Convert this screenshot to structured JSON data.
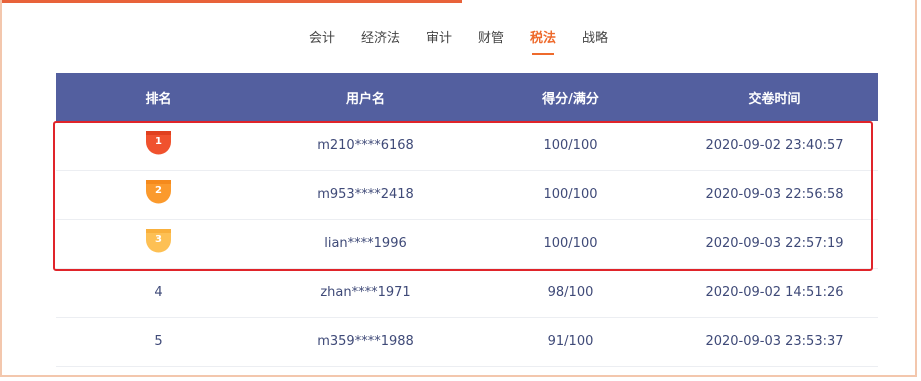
{
  "tabs": [
    {
      "label": "会计",
      "active": false
    },
    {
      "label": "经济法",
      "active": false
    },
    {
      "label": "审计",
      "active": false
    },
    {
      "label": "财管",
      "active": false
    },
    {
      "label": "税法",
      "active": true
    },
    {
      "label": "战略",
      "active": false
    }
  ],
  "table": {
    "headers": [
      "排名",
      "用户名",
      "得分/满分",
      "交卷时间"
    ],
    "rows": [
      {
        "rank": "1",
        "user": "m210****6168",
        "score": "100/100",
        "time": "2020-09-02 23:40:57",
        "medal_color": "#f0522e"
      },
      {
        "rank": "2",
        "user": "m953****2418",
        "score": "100/100",
        "time": "2020-09-03 22:56:58",
        "medal_color": "#fb9a2d"
      },
      {
        "rank": "3",
        "user": "lian****1996",
        "score": "100/100",
        "time": "2020-09-03 22:57:19",
        "medal_color": "#fdc054"
      },
      {
        "rank": "4",
        "user": "zhan****1971",
        "score": "98/100",
        "time": "2020-09-02 14:51:26"
      },
      {
        "rank": "5",
        "user": "m359****1988",
        "score": "91/100",
        "time": "2020-09-03 23:53:37"
      }
    ]
  },
  "colors": {
    "header_bg": "#535f9f",
    "active_tab": "#ee6a2c",
    "highlight_border": "#e0242a"
  }
}
